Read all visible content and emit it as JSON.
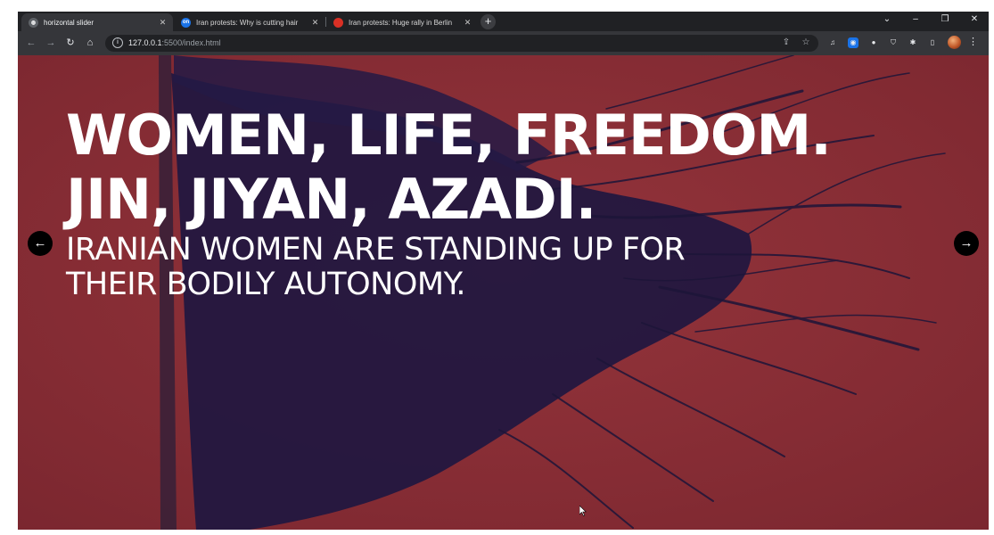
{
  "browser": {
    "tabs": [
      {
        "title": "horizontal slider",
        "active": true,
        "favicon": "globe-icon"
      },
      {
        "title": "Iran protests: Why is cutting hair",
        "active": false,
        "favicon": "on-logo-icon",
        "favicon_text": "on"
      },
      {
        "title": "Iran protests: Huge rally in Berlin",
        "active": false,
        "favicon": "news-logo-icon"
      }
    ],
    "new_tab_label": "+",
    "window_controls": {
      "chevron": "⌄",
      "minimize": "–",
      "restore": "❐",
      "close": "✕"
    },
    "address": {
      "host": "127.0.0.1",
      "rest": ":5500/index.html"
    }
  },
  "page": {
    "headline_line1": "WOMEN, LIFE, FREEDOM.",
    "headline_line2": "JIN, JIYAN, AZADI.",
    "subline_line1": "IRANIAN WOMEN ARE STANDING UP FOR",
    "subline_line2": "THEIR BODILY AUTONOMY.",
    "prev_arrow": "←",
    "next_arrow": "→"
  },
  "colors": {
    "background": "#8d2d35",
    "flag_shadow": "#1f1740",
    "text": "#ffffff",
    "arrow_button": "#000000"
  }
}
